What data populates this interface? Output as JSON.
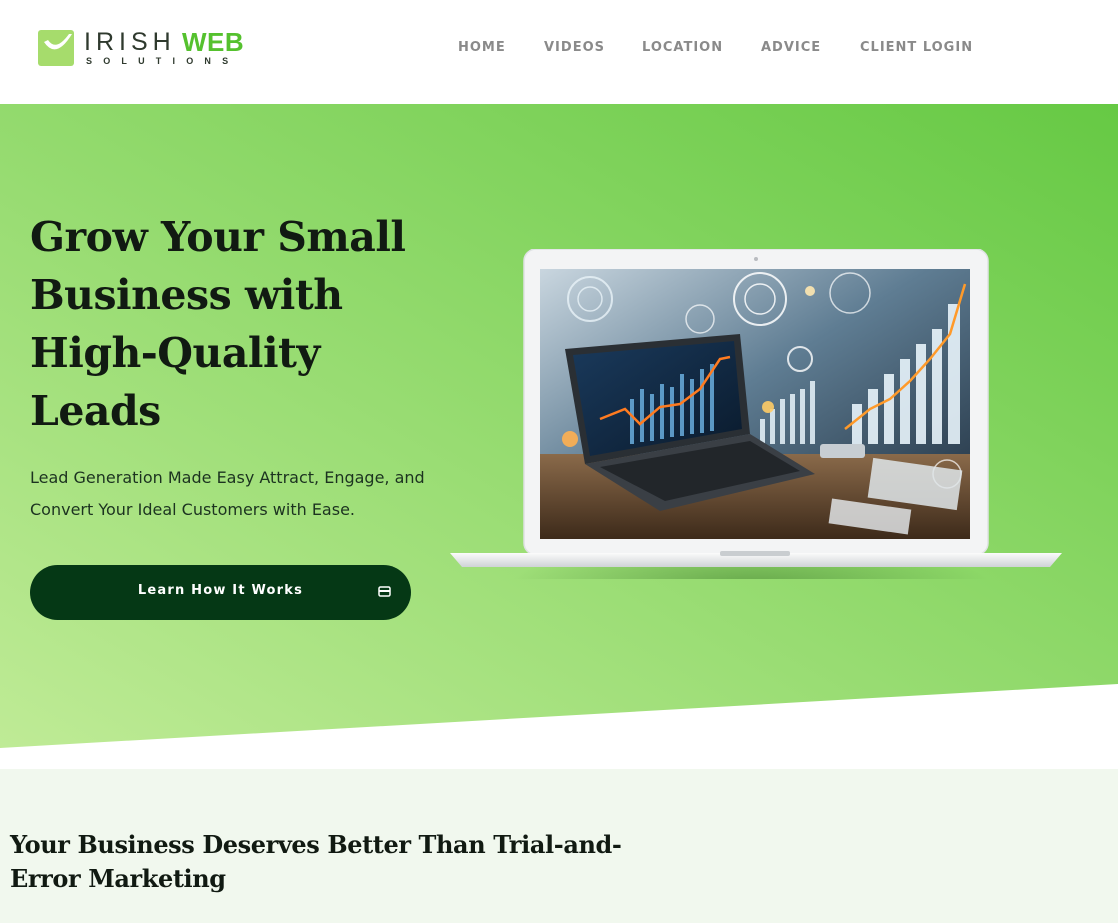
{
  "header": {
    "logo": {
      "word_1": "IRISH",
      "word_2": "WEB",
      "sub": "SOLUTIONS",
      "accent_color": "#55c12e",
      "mark_color": "#a6dc6c",
      "icon": "check-badge-icon"
    },
    "nav": {
      "home": "HOME",
      "videos": "VIDEOS",
      "location": "LOCATION",
      "advice": "ADVICE",
      "client_login": "CLIENT LOGIN"
    }
  },
  "hero": {
    "title": "Grow Your Small Business with High-Quality Leads",
    "subtitle": "Lead Generation Made Easy Attract, Engage, and Convert Your Ideal Customers with Ease.",
    "cta_label": "Learn How It Works",
    "cta_icon": "card-icon",
    "gradient_start": "#bfeb96",
    "gradient_end": "#66c944",
    "cta_color": "#053815",
    "illustration": "laptop-analytics-illustration"
  },
  "section_two": {
    "title": "Your Business Deserves Better Than Trial-and-Error Marketing",
    "background": "#f1f8ee"
  }
}
